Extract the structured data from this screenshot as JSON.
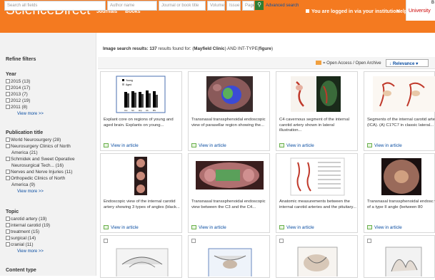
{
  "header": {
    "logo": "ScienceDirect",
    "nav": [
      "Journals",
      "Books"
    ],
    "logged_in": "You are logged in via your institution",
    "help": "Help",
    "institution": "University",
    "institution_initial": "B"
  },
  "search": {
    "fields": [
      "Search all fields",
      "Author name",
      "Journal or book title",
      "Volume",
      "Issue",
      "Page"
    ],
    "advanced": "Advanced search"
  },
  "sidebar": {
    "refine": "Refine filters",
    "year_title": "Year",
    "years": [
      "2015 (13)",
      "2014 (17)",
      "2013 (7)",
      "2012 (19)",
      "2011 (8)"
    ],
    "pub_title": "Publication title",
    "pubs": [
      "World Neurosurgery (28)",
      "Neurosurgery Clinics of North",
      "America (21)",
      "Schmidek and Sweet Operative",
      "Neurosurgical Tech... (16)",
      "Nerves and Nerve Injuries (11)",
      "Orthopedic Clinics of North",
      "America (9)"
    ],
    "topic_title": "Topic",
    "topics": [
      "carotid artery (19)",
      "internal carotid (19)",
      "treatment (15)",
      "surgical (14)",
      "cranial (11)"
    ],
    "view_more": "View more >>",
    "content_title": "Content type"
  },
  "results": {
    "prefix": "Image search results:",
    "count": "137",
    "suffix": "results found for: (",
    "query": "Mayfield Clinic",
    "mid": ") AND INT-TYPE(",
    "type": "figure",
    "end": ")"
  },
  "toolbar": {
    "open_access": "= Open Access / Open Archive",
    "sort": "Relevance"
  },
  "cards": [
    {
      "caption": "Explant core on regions of young and aged brain. Explants on young..."
    },
    {
      "caption": "Transnasal transsphenoidal endoscopic view of parasellar region showing the..."
    },
    {
      "caption": "C4 cavernous segment of the internal carotid artery shown in lateral illustration..."
    },
    {
      "caption": "Segments of the internal carotid arte (ICA). (A) C1?C7 in classic lateral..."
    },
    {
      "caption": "Endoscopic view of the internal carotid artery showing 3 types of angles (black..."
    },
    {
      "caption": "Transnasal transsphenoidal endoscopic view between the C3 and the C4..."
    },
    {
      "caption": "Anatomic measurements between the internal carotid arteries and the pituitary..."
    },
    {
      "caption": "Transnasal transsphenoidal endosc view of a type II angle (between 80"
    }
  ],
  "view_in_article": "View in article",
  "thumb_chart_legend": [
    "Young",
    "Aged"
  ],
  "thumb_chart_categories": [
    "Ctx",
    "Str",
    "Hip",
    "Cb",
    "BS"
  ]
}
